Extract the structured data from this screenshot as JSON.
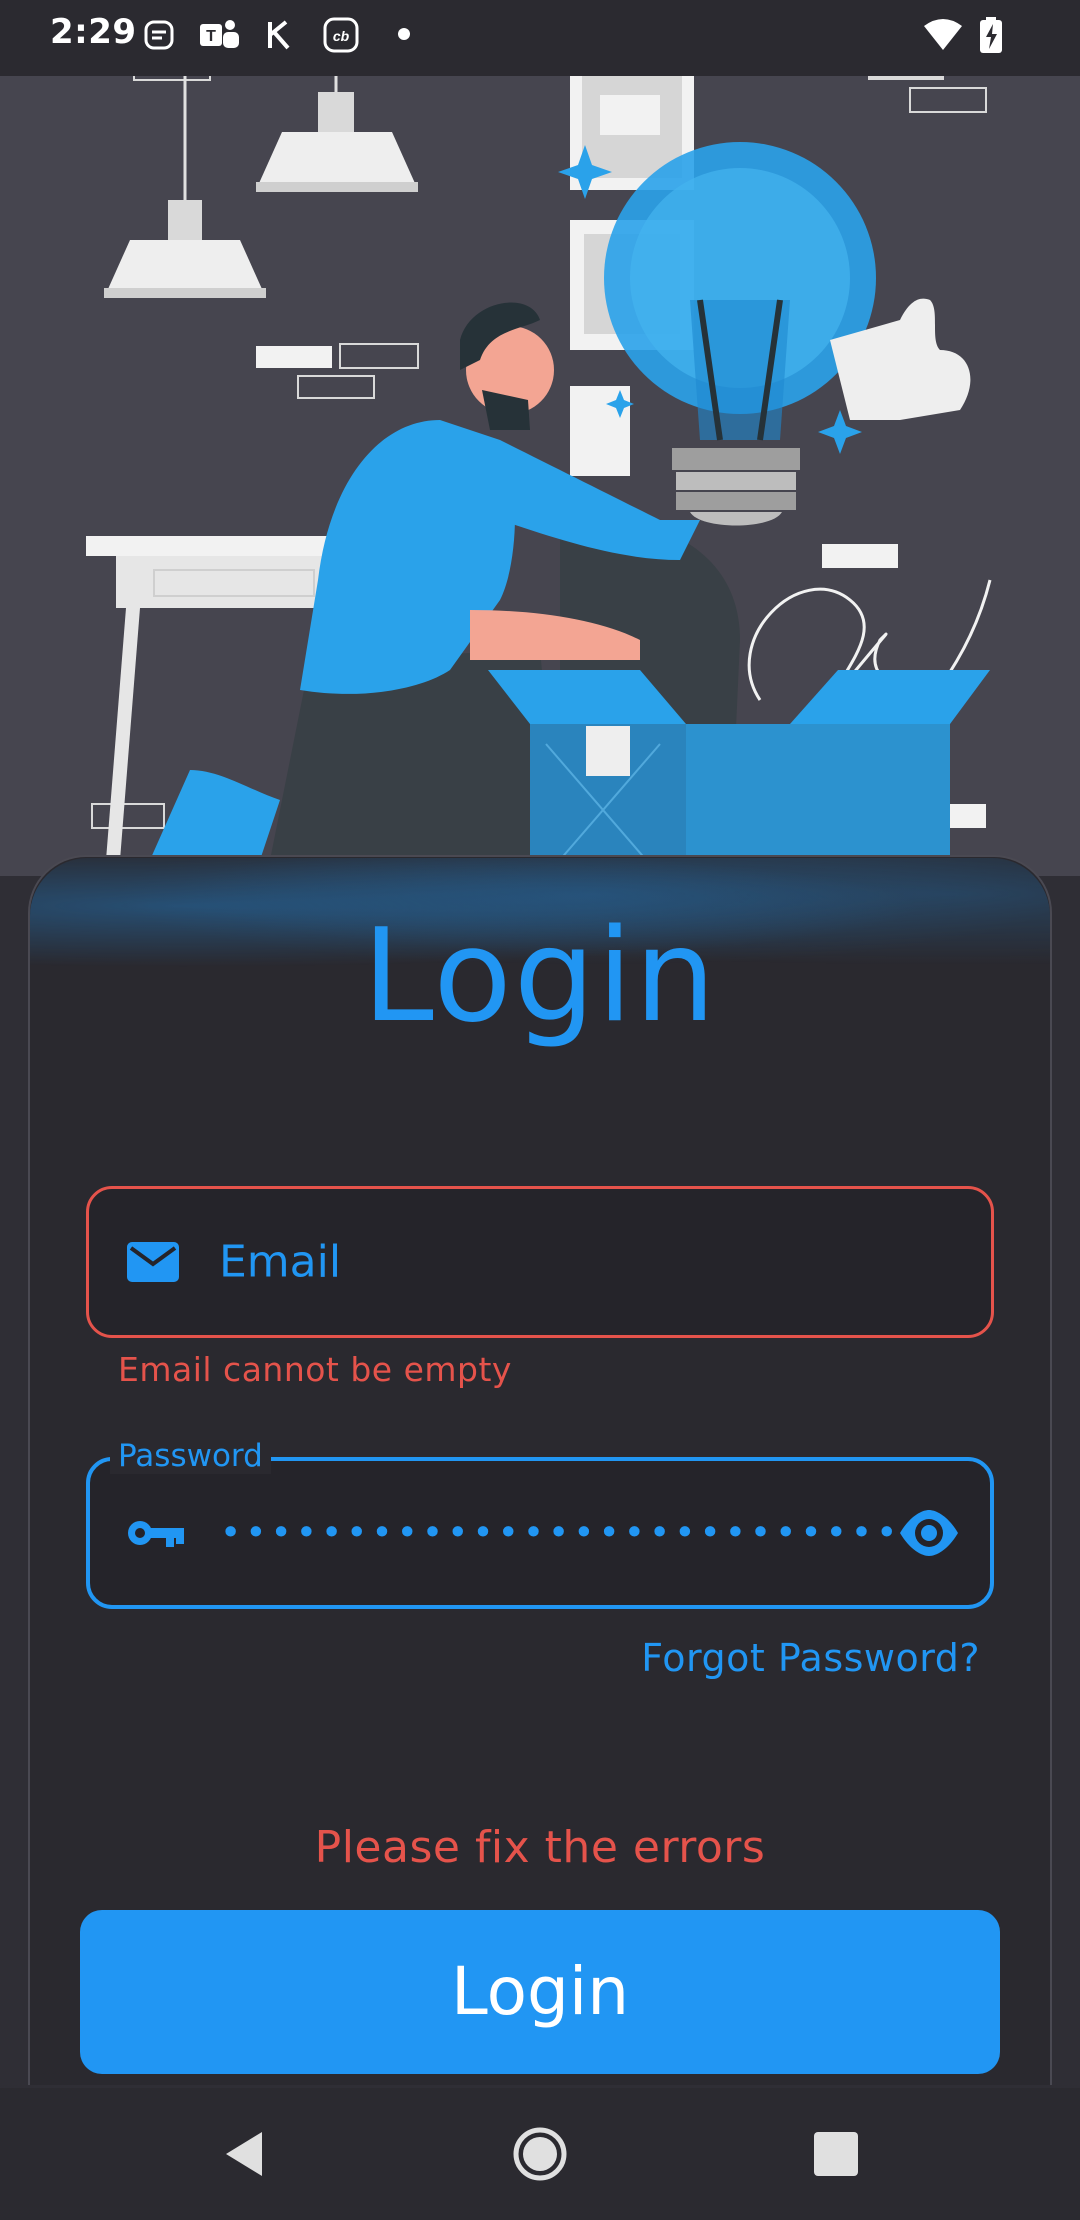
{
  "status_bar": {
    "time": "2:29",
    "icons": [
      "notification-app-icon",
      "teams-icon",
      "app-icon",
      "cb-icon",
      "dot-icon",
      "wifi-icon",
      "battery-charging-icon"
    ]
  },
  "hero": {
    "illustration": "person-with-lightbulb-and-box-illustration"
  },
  "login": {
    "title": "Login",
    "email": {
      "placeholder": "Email",
      "error": "Email cannot be empty",
      "icon": "email-icon"
    },
    "password": {
      "label": "Password",
      "masked_value": "••••••••••••••••••••••••••••••",
      "icon": "key-icon",
      "toggle_icon": "eye-icon"
    },
    "forgot_password": "Forgot Password?",
    "form_error": "Please fix the errors",
    "submit_label": "Login"
  },
  "colors": {
    "accent": "#2196f3",
    "error": "#e5534b",
    "background": "#2a292f"
  },
  "nav_bar": {
    "buttons": [
      "back-icon",
      "home-icon",
      "recents-icon"
    ]
  }
}
